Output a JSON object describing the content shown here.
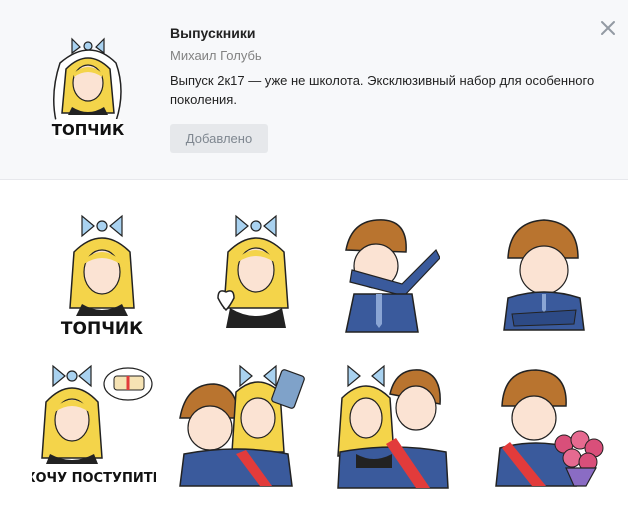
{
  "pack": {
    "title": "Выпускники",
    "author": "Михаил Голубь",
    "description": "Выпуск 2к17 — уже не школота. Эксклюзивный набор для особенного поколения.",
    "button_label": "Добавлено",
    "cover_caption": "ТОПЧИК"
  },
  "stickers": [
    {
      "name": "girl-topchik",
      "caption": "ТОПЧИК"
    },
    {
      "name": "girl-heart",
      "caption": ""
    },
    {
      "name": "boy-dab",
      "caption": ""
    },
    {
      "name": "boy-arms-crossed",
      "caption": ""
    },
    {
      "name": "girl-hochu-postupit",
      "caption": "ХОЧУ ПОСТУПИТЬ"
    },
    {
      "name": "couple-selfie",
      "caption": ""
    },
    {
      "name": "couple-hug",
      "caption": ""
    },
    {
      "name": "boy-flowers",
      "caption": ""
    }
  ],
  "colors": {
    "header_bg": "#f7f8fa",
    "button_bg": "#e6e8eb",
    "hair_blonde": "#f4d44a",
    "hair_brown": "#b9742f",
    "bow": "#a9d2f0",
    "suit": "#3a5a9c",
    "sash": "#e23b3b"
  }
}
